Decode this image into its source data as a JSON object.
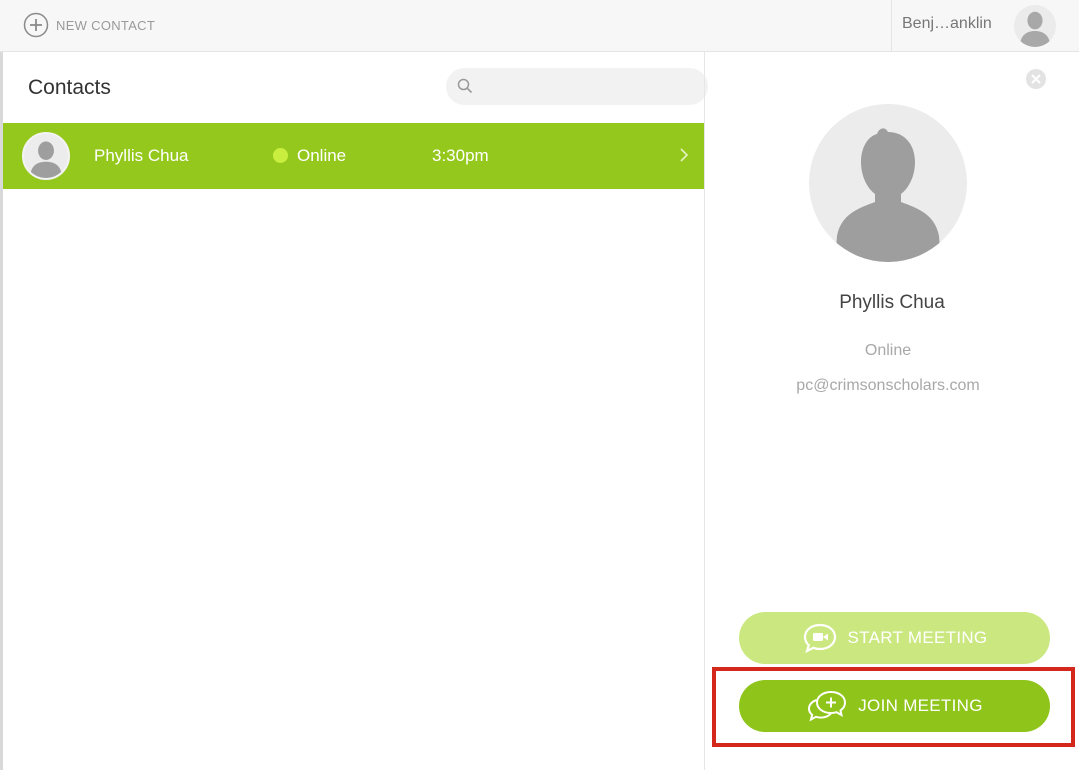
{
  "topbar": {
    "new_contact_label": "NEW CONTACT",
    "user_name": "Benj…anklin"
  },
  "contacts": {
    "title": "Contacts",
    "search_placeholder": "",
    "rows": [
      {
        "name": "Phyllis Chua",
        "status": "Online",
        "time": "3:30pm"
      }
    ]
  },
  "detail": {
    "name": "Phyllis Chua",
    "status": "Online",
    "email": "pc@crimsonscholars.com"
  },
  "actions": {
    "start_label": "START MEETING",
    "join_label": "JOIN MEETING"
  },
  "colors": {
    "accent": "#95c81d",
    "accent_light": "#cbe880",
    "online": "#c9ee3f",
    "highlight": "#d5281c"
  },
  "icons": [
    "plus-circle-icon",
    "avatar-icon",
    "search-icon",
    "chevron-right-icon",
    "close-icon",
    "video-chat-icon",
    "chat-plus-icon"
  ]
}
